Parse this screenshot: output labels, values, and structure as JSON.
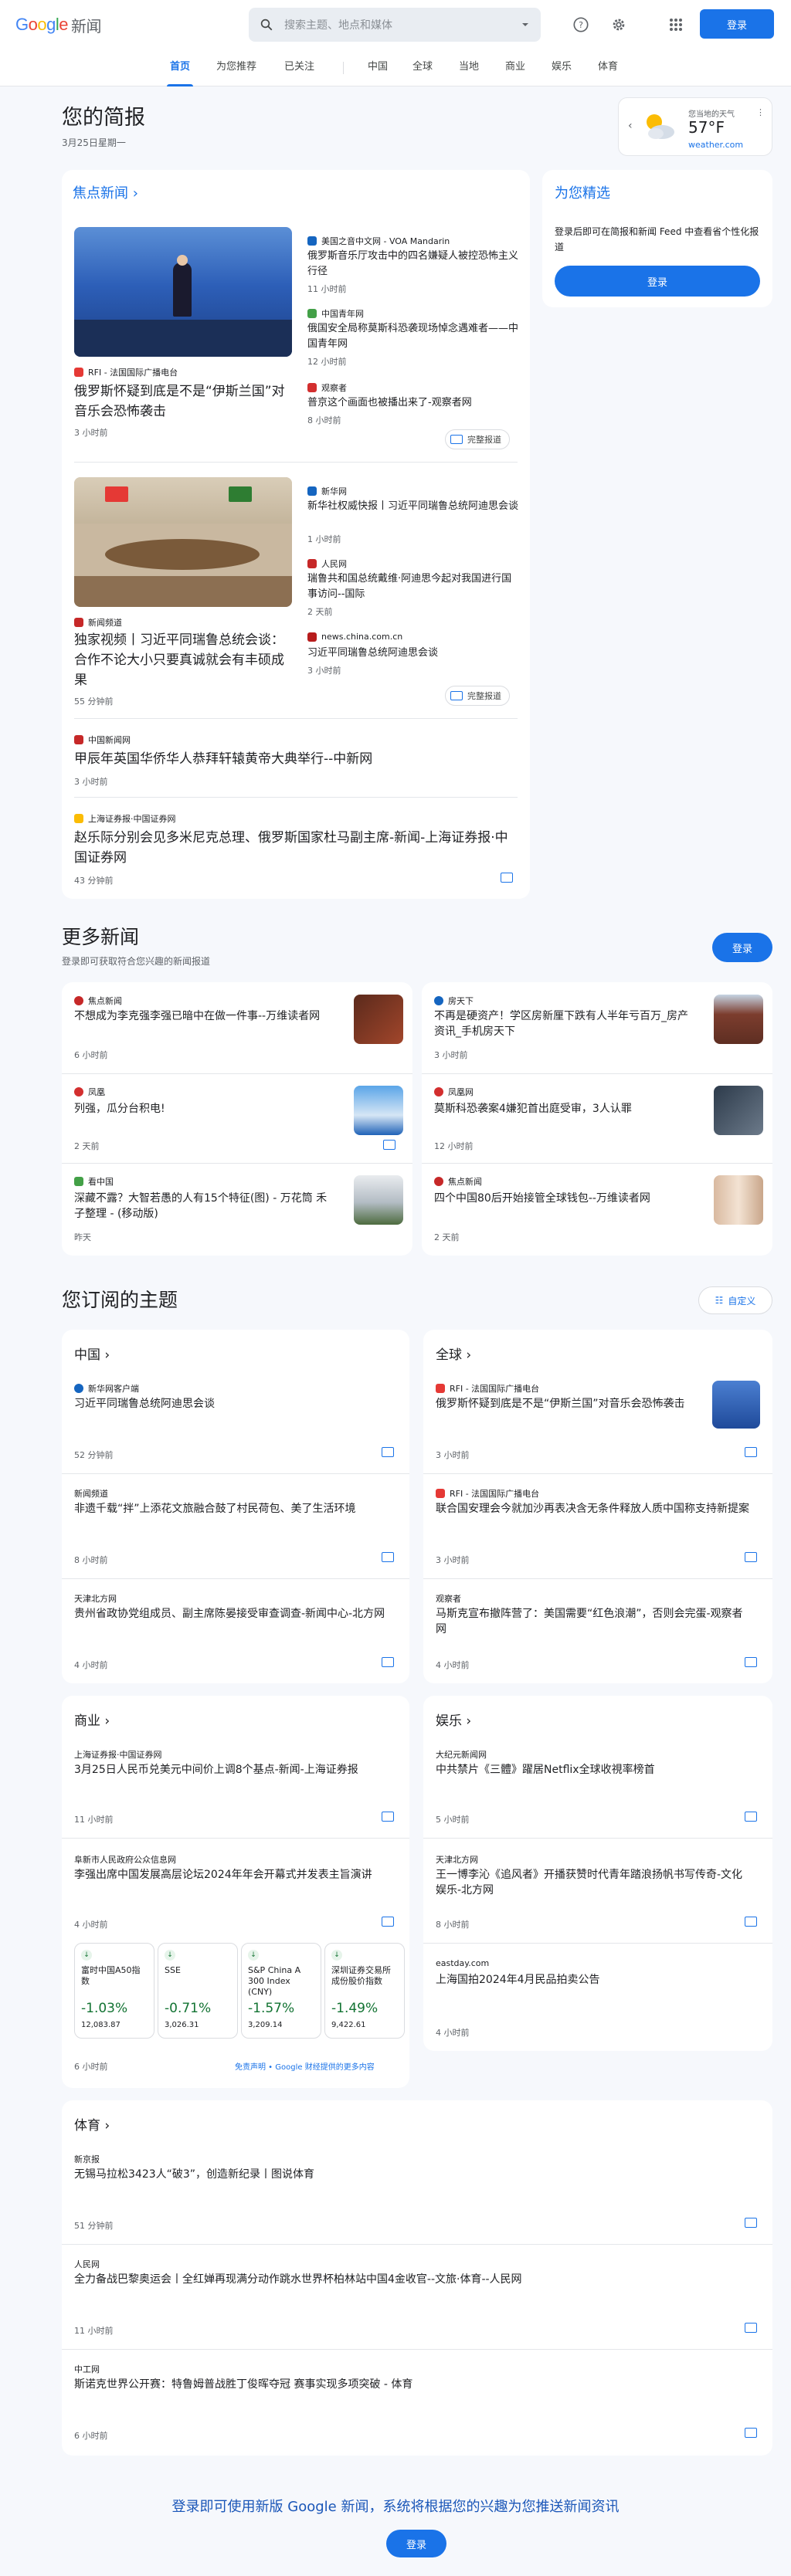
{
  "header": {
    "logo": {
      "g1": "G",
      "g2": "o",
      "g3": "o",
      "g4": "g",
      "g5": "l",
      "g6": "e",
      "news": "新闻"
    },
    "search_placeholder": "搜索主题、地点和媒体",
    "signin": "登录"
  },
  "tabs": [
    {
      "label": "首页"
    },
    {
      "label": "为您推荐"
    },
    {
      "label": "已关注"
    },
    {
      "label": "中国"
    },
    {
      "label": "全球"
    },
    {
      "label": "当地"
    },
    {
      "label": "商业"
    },
    {
      "label": "娱乐"
    },
    {
      "label": "体育"
    }
  ],
  "brief": {
    "title": "您的简报",
    "date": "3月25日星期一"
  },
  "weather": {
    "label": "您当地的天气",
    "temp": "57°F",
    "source": "weather.com"
  },
  "headlines": {
    "title": "焦点新闻",
    "clusters": [
      {
        "main": {
          "source": "RFI - 法国国际广播电台",
          "headline": "俄罗斯怀疑到底是不是“伊斯兰国”对音乐会恐怖袭击",
          "time": "3 小时前"
        },
        "side": [
          {
            "source": "美国之音中文网 - VOA Mandarin",
            "headline": "俄罗斯音乐厅攻击中的四名嫌疑人被控恐怖主义行径",
            "time": "11 小时前"
          },
          {
            "source": "中国青年网",
            "headline": "俄国安全局称莫斯科恐袭现场悼念遇难者——中国青年网",
            "time": "12 小时前"
          },
          {
            "source": "观察者",
            "headline": "普京这个画面也被播出来了-观察者网",
            "time": "8 小时前"
          }
        ],
        "coverage": "完整报道"
      },
      {
        "main": {
          "source": "新闻频道",
          "headline": "独家视频丨习近平同瑞鲁总统会谈：合作不论大小只要真诚就会有丰硕成果",
          "time": "55 分钟前"
        },
        "side": [
          {
            "source": "新华网",
            "headline": "新华社权威快报丨习近平同瑞鲁总统阿迪思会谈",
            "time": "1 小时前"
          },
          {
            "source": "人民网",
            "headline": "瑞鲁共和国总统戴维·阿迪思今起对我国进行国事访问--国际",
            "time": "2 天前"
          },
          {
            "source": "news.china.com.cn",
            "headline": "习近平同瑞鲁总统阿迪思会谈",
            "time": "3 小时前"
          }
        ],
        "coverage": "完整报道"
      }
    ],
    "singles": [
      {
        "source": "中国新闻网",
        "headline": "甲辰年英国华侨华人恭拜轩辕黄帝大典举行--中新网",
        "time": "3 小时前"
      },
      {
        "source": "上海证券报·中国证券网",
        "headline": "赵乐际分别会见多米尼克总理、俄罗斯国家杜马副主席-新闻-上海证券报·中国证券网",
        "time": "43 分钟前"
      }
    ]
  },
  "picks": {
    "title": "为您精选",
    "desc": "登录后即可在简报和新闻 Feed 中查看省个性化报道",
    "signin": "登录"
  },
  "more": {
    "title": "更多新闻",
    "subtitle": "登录即可获取符合您兴趣的新闻报道",
    "signin": "登录",
    "items": [
      {
        "source": "焦点新闻",
        "headline": "不想成为李克强李强已暗中在做一件事--万维读者网",
        "time": "6 小时前"
      },
      {
        "source": "房天下",
        "headline": "不再是硬资产！学区房新厘下跌有人半年亏百万_房产资讯_手机房天下",
        "time": "3 小时前"
      },
      {
        "source": "凤凰",
        "headline": "列强，瓜分台积电!",
        "time": "2 天前"
      },
      {
        "source": "凤凰网",
        "headline": "莫斯科恐袭案4嫌犯首出庭受审，3人认罪",
        "time": "12 小时前"
      },
      {
        "source": "看中国",
        "headline": "深藏不露？大智若愚的人有15个特征(图) - 万花筒 禾子整理 - (移动版)",
        "time": "昨天"
      },
      {
        "source": "焦点新闻",
        "headline": "四个中国80后开始接管全球钱包--万维读者网",
        "time": "2 天前"
      }
    ]
  },
  "topics": {
    "title": "您订阅的主题",
    "customize": "自定义",
    "china": {
      "title": "中国",
      "items": [
        {
          "source": "新华网客户端",
          "headline": "习近平同瑞鲁总统阿迪思会谈",
          "time": "52 分钟前"
        },
        {
          "source": "新闻频道",
          "headline": "非遗千载“拌”上添花文旅融合鼓了村民荷包、美了生活环境",
          "time": "8 小时前"
        },
        {
          "source": "天津北方网",
          "headline": "贵州省政协党组成员、副主席陈晏接受审查调查-新闻中心-北方网",
          "time": "4 小时前"
        }
      ]
    },
    "world": {
      "title": "全球",
      "items": [
        {
          "source": "RFI - 法国国际广播电台",
          "headline": "俄罗斯怀疑到底是不是“伊斯兰国”对音乐会恐怖袭击",
          "time": "3 小时前"
        },
        {
          "source": "RFI - 法国国际广播电台",
          "headline": "联合国安理会今就加沙再表决含无条件释放人质中国称支持新提案",
          "time": "3 小时前"
        },
        {
          "source": "观察者",
          "headline": "马斯克宣布撤阵营了：美国需要“红色浪潮”，否则会完蛋-观察者网",
          "time": "4 小时前"
        }
      ]
    },
    "business": {
      "title": "商业",
      "items": [
        {
          "source": "上海证券报·中国证券网",
          "headline": "3月25日人民币兑美元中间价上调8个基点-新闻-上海证券报",
          "time": "11 小时前"
        },
        {
          "source": "阜新市人民政府公众信息网",
          "headline": "李强出席中国发展高层论坛2024年年会开幕式并发表主旨演讲",
          "time": "4 小时前"
        }
      ],
      "stocks": [
        {
          "name": "富时中国A50指数",
          "change": "-1.03%",
          "value": "12,083.87"
        },
        {
          "name": "SSE",
          "change": "-0.71%",
          "value": "3,026.31"
        },
        {
          "name": "S&P China A 300 Index (CNY)",
          "change": "-1.57%",
          "value": "3,209.14"
        },
        {
          "name": "深圳证券交易所成份股价指数",
          "change": "-1.49%",
          "value": "9,422.61"
        }
      ],
      "stocks_time": "6 小时前",
      "stocks_disclaimer": "免责声明 • Google 财经提供的更多内容"
    },
    "ent": {
      "title": "娱乐",
      "items": [
        {
          "source": "大纪元新闻网",
          "headline": "中共禁片《三體》躍居Netflix全球收視率榜首",
          "time": "5 小时前"
        },
        {
          "source": "天津北方网",
          "headline": "王一博李沁《追风者》开播获赞时代青年踏浪扬帆书写传奇-文化娱乐-北方网",
          "time": "8 小时前"
        },
        {
          "source": "eastday.com",
          "headline": "上海国拍2024年4月民品拍卖公告",
          "time": "4 小时前"
        }
      ]
    },
    "sports": {
      "title": "体育",
      "items": [
        {
          "source": "新京报",
          "headline": "无锡马拉松3423人“破3”，创造新纪录丨图说体育",
          "time": "51 分钟前"
        },
        {
          "source": "人民网",
          "headline": "全力备战巴黎奥运会丨全红婵再现满分动作跳水世界杯柏林站中国4金收官--文旅·体育--人民网",
          "time": "11 小时前"
        },
        {
          "source": "中工网",
          "headline": "斯诺克世界公开赛：特鲁姆普战胜丁俊晖夺冠 赛事实现多项突破 - 体育",
          "time": "6 小时前"
        }
      ]
    }
  },
  "footer": {
    "text": "登录即可使用新版 Google 新闻，系统将根据您的兴趣为您推送新闻资讯",
    "signin": "登录"
  },
  "colors": {
    "accent": "#1a73e8",
    "positive": "#137333",
    "bg": "#f6f8fc"
  }
}
